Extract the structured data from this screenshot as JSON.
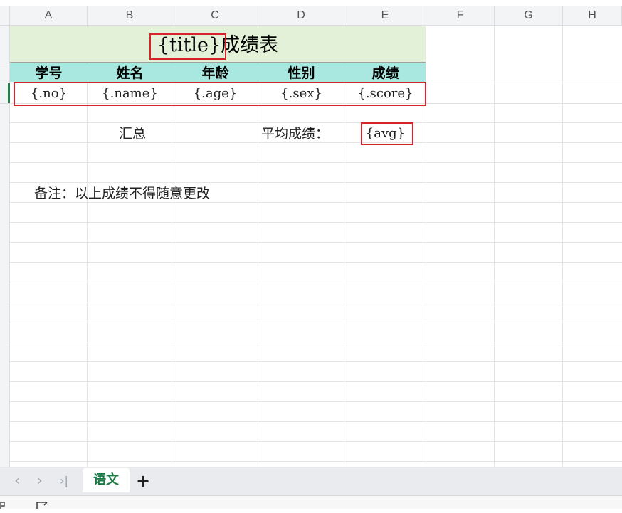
{
  "columns": [
    "A",
    "B",
    "C",
    "D",
    "E",
    "F",
    "G",
    "H"
  ],
  "title_cell": {
    "template": "{title}",
    "suffix": "成绩表"
  },
  "headers": [
    "学号",
    "姓名",
    "年龄",
    "性别",
    "成绩"
  ],
  "data_row": [
    "{.no}",
    "{.name}",
    "{.age}",
    "{.sex}",
    "{.score}"
  ],
  "summary": {
    "label": "汇总",
    "avg_label": "平均成绩：",
    "avg_value": "{avg}"
  },
  "note": "备注：以上成绩不得随意更改",
  "sheet_tabs": {
    "active": "语文",
    "add": "+"
  },
  "nav": {
    "prev": "‹",
    "next": "›",
    "last": "›|"
  },
  "colors": {
    "title_bg": "#e3f1d8",
    "header_bg": "#a8e8e0",
    "highlight": "#d8232a",
    "active_tab": "#1b7a43"
  }
}
